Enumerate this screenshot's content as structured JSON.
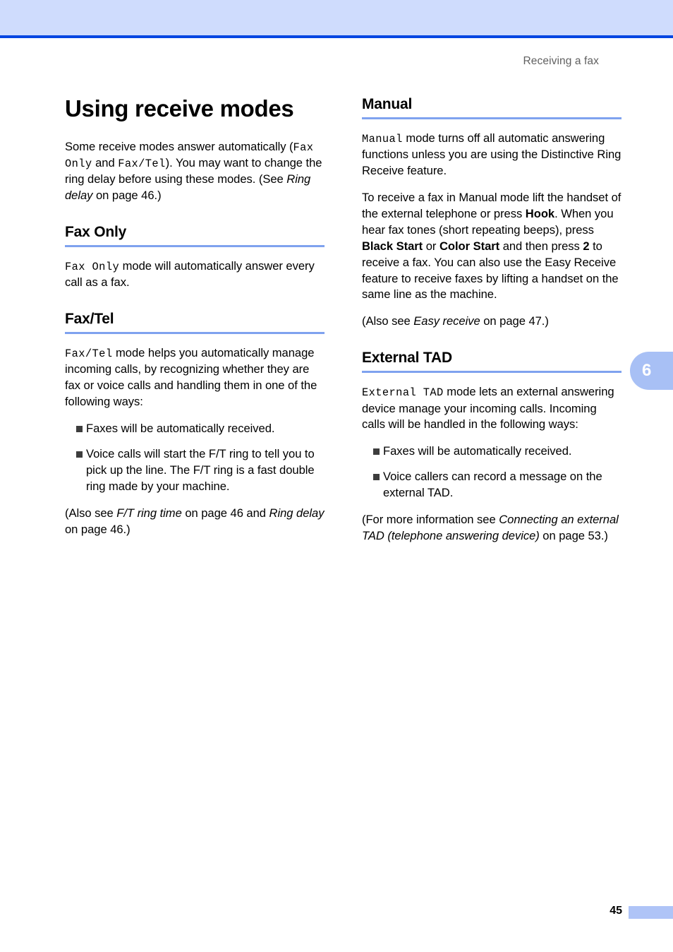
{
  "header": {
    "running_head": "Receiving a fax",
    "band_color": "#cfdcfd",
    "rule_color": "#0546e2"
  },
  "chapter_tab": {
    "number": "6",
    "color": "#a8c0f5"
  },
  "footer": {
    "page_number": "45",
    "block_color": "#afc4f7"
  },
  "left_column": {
    "title": "Using receive modes",
    "intro": {
      "t1": "Some receive modes answer automatically (",
      "code1": "Fax Only",
      "t2": " and ",
      "code2": "Fax/Tel",
      "t3": "). You may want to change the ring delay before using these modes. (See ",
      "ital1": "Ring delay",
      "t4": " on page 46.)"
    },
    "sections": [
      {
        "heading": "Fax Only",
        "para": {
          "code1": "Fax Only",
          "t1": " mode will automatically answer every call as a fax."
        }
      },
      {
        "heading": "Fax/Tel",
        "para": {
          "code1": "Fax/Tel",
          "t1": " mode helps you automatically manage incoming calls, by recognizing whether they are fax or voice calls and handling them in one of the following ways:"
        },
        "bullets": [
          "Faxes will be automatically received.",
          "Voice calls will start the F/T ring to tell you to pick up the line. The F/T ring is a fast double ring made by your machine."
        ],
        "note": {
          "t1": "(Also see ",
          "ital1": "F/T ring time",
          "t2": " on page 46 and ",
          "ital2": "Ring delay",
          "t3": " on page 46.)"
        }
      }
    ]
  },
  "right_column": {
    "sections": [
      {
        "heading": "Manual",
        "para1": {
          "code1": "Manual",
          "t1": " mode turns off all automatic answering functions unless you are using the Distinctive Ring Receive feature."
        },
        "para2": {
          "t1": "To receive a fax in Manual mode lift the handset of the external telephone or press ",
          "bold1": "Hook",
          "t2": ". When you hear fax tones (short repeating beeps), press ",
          "bold2": "Black Start",
          "t3": " or ",
          "bold3": "Color Start",
          "t4": " and then press ",
          "bold4": "2",
          "t5": " to receive a fax. You can also use the Easy Receive feature to receive faxes by lifting a handset on the same line as the machine."
        },
        "note": {
          "t1": "(Also see ",
          "ital1": "Easy receive",
          "t2": " on page 47.)"
        }
      },
      {
        "heading": "External TAD",
        "para1": {
          "code1": "External TAD",
          "t1": " mode lets an external answering device manage your incoming calls. Incoming calls will be handled in the following ways:"
        },
        "bullets": [
          "Faxes will be automatically received.",
          "Voice callers can record a message on the external TAD."
        ],
        "note": {
          "t1": "(For more information see ",
          "ital1": "Connecting an external TAD (telephone answering device)",
          "t2": " on page 53.)"
        }
      }
    ]
  }
}
